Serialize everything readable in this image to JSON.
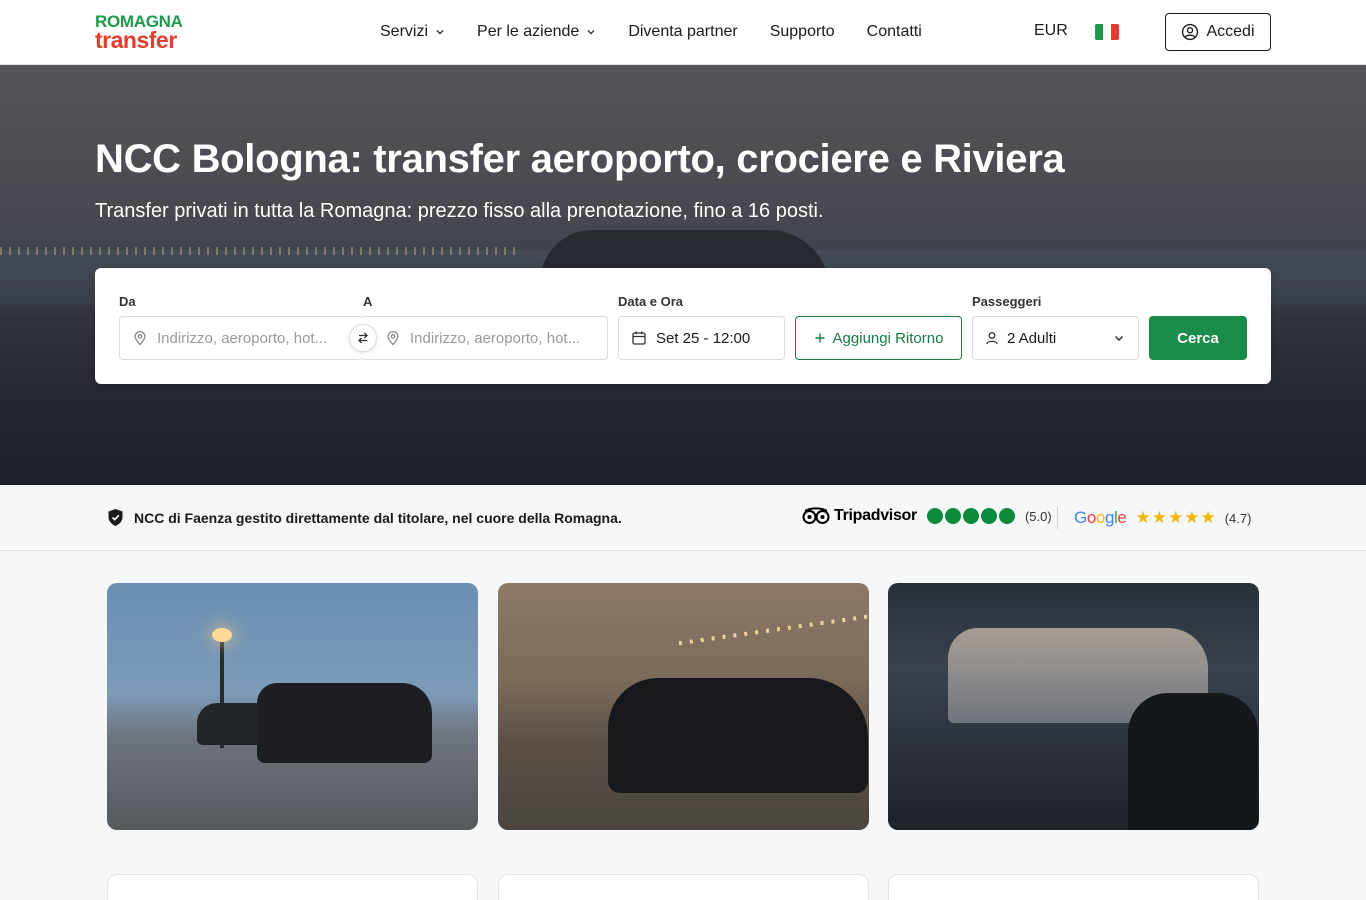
{
  "header": {
    "logo_line1": "ROMAGNA",
    "logo_line2": "transfer",
    "nav": [
      {
        "label": "Servizi",
        "has_dropdown": true
      },
      {
        "label": "Per le aziende",
        "has_dropdown": true
      },
      {
        "label": "Diventa partner",
        "has_dropdown": false
      },
      {
        "label": "Supporto",
        "has_dropdown": false
      },
      {
        "label": "Contatti",
        "has_dropdown": false
      }
    ],
    "currency": "EUR",
    "language_flag": "italy-flag",
    "login_label": "Accedi"
  },
  "hero": {
    "title": "NCC Bologna: transfer aeroporto, crociere e Riviera",
    "subtitle": "Transfer privati in tutta la Romagna: prezzo fisso alla prenotazione, fino a 16 posti."
  },
  "search": {
    "from_label": "Da",
    "from_placeholder": "Indirizzo, aeroporto, hot...",
    "to_label": "A",
    "to_placeholder": "Indirizzo, aeroporto, hot...",
    "datetime_label": "Data e Ora",
    "datetime_value": "Set 25 - 12:00",
    "return_button": "Aggiungi Ritorno",
    "passengers_label": "Passeggeri",
    "passengers_value": "2 Adulti",
    "search_button": "Cerca"
  },
  "trust": {
    "text": "NCC di Faenza gestito direttamente dal titolare, nel cuore della Romagna.",
    "tripadvisor_name": "Tripadvisor",
    "tripadvisor_rating": "(5.0)",
    "google_name": "Google",
    "google_rating": "(4.7)"
  },
  "colors": {
    "brand_green": "#1a8c4a",
    "brand_red": "#e23d2f",
    "tripadvisor_green": "#0a8a3a",
    "star_yellow": "#f2b705"
  }
}
